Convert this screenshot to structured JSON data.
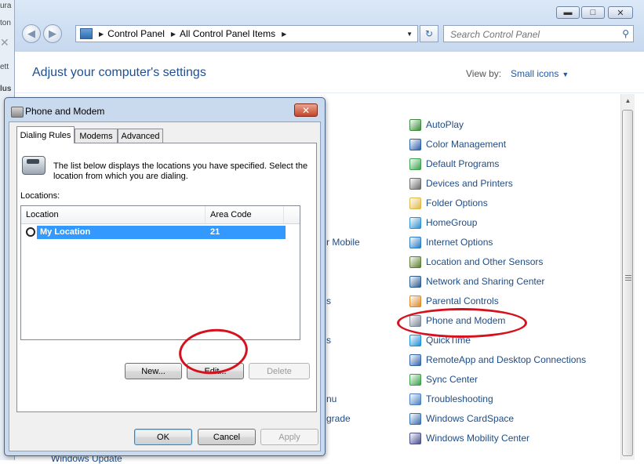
{
  "window": {
    "buttons": {
      "minimize": "▬",
      "maximize": "□",
      "close": "✕"
    }
  },
  "address": {
    "crumbs": [
      "Control Panel",
      "All Control Panel Items"
    ],
    "separator": "▶",
    "dropdown": "▼",
    "refresh": "↻"
  },
  "search": {
    "placeholder": "Search Control Panel",
    "icon": "search-icon"
  },
  "header": {
    "title": "Adjust your computer's settings",
    "view_by_label": "View by:",
    "view_by_value": "Small icons",
    "view_by_arrow": "▼"
  },
  "items": [
    {
      "label": "AutoPlay",
      "icon": "autoplay-icon",
      "color": "#3a8c3a"
    },
    {
      "label": "Color Management",
      "icon": "color-management-icon",
      "color": "#2d5ea8"
    },
    {
      "label": "Default Programs",
      "icon": "default-programs-icon",
      "color": "#3aa14a"
    },
    {
      "label": "Devices and Printers",
      "icon": "printer-icon",
      "color": "#6b6b6b"
    },
    {
      "label": "Folder Options",
      "icon": "folder-icon",
      "color": "#e0b84a"
    },
    {
      "label": "HomeGroup",
      "icon": "homegroup-icon",
      "color": "#2f8fd0"
    },
    {
      "label": "Internet Options",
      "icon": "internet-options-icon",
      "color": "#2a7bc1"
    },
    {
      "label": "Location and Other Sensors",
      "icon": "location-sensors-icon",
      "color": "#5b7f2e"
    },
    {
      "label": "Network and Sharing Center",
      "icon": "network-icon",
      "color": "#2f5c8f"
    },
    {
      "label": "Parental Controls",
      "icon": "parental-controls-icon",
      "color": "#d98a2b"
    },
    {
      "label": "Phone and Modem",
      "icon": "phone-modem-icon",
      "color": "#7c8794"
    },
    {
      "label": "QuickTime",
      "icon": "quicktime-icon",
      "color": "#1b8fd6"
    },
    {
      "label": "RemoteApp and Desktop Connections",
      "icon": "remoteapp-icon",
      "color": "#3565a8"
    },
    {
      "label": "Sync Center",
      "icon": "sync-center-icon",
      "color": "#3aa14a"
    },
    {
      "label": "Troubleshooting",
      "icon": "troubleshooting-icon",
      "color": "#4a7fc0"
    },
    {
      "label": "Windows CardSpace",
      "icon": "cardspace-icon",
      "color": "#3a6fb0"
    },
    {
      "label": "Windows Mobility Center",
      "icon": "mobility-center-icon",
      "color": "#4a4f8c"
    }
  ],
  "hidden_fragments": {
    "mobile": "r Mobile",
    "s1": "s",
    "s2": "s",
    "nu": "nu",
    "grade": "grade",
    "bottom": "Windows Update"
  },
  "dialog": {
    "title": "Phone and Modem",
    "close": "✕",
    "tabs": [
      "Dialing Rules",
      "Modems",
      "Advanced"
    ],
    "description": "The list below displays the locations you have specified. Select the location from which you are dialing.",
    "locations_label": "Locations:",
    "columns": [
      "Location",
      "Area Code"
    ],
    "rows": [
      {
        "location": "My Location",
        "area_code": "21"
      }
    ],
    "buttons": {
      "new": "New...",
      "edit": "Edit...",
      "delete": "Delete"
    },
    "footer": {
      "ok": "OK",
      "cancel": "Cancel",
      "apply": "Apply"
    }
  },
  "scrollbar": {
    "up_arrow": "▲"
  },
  "left_strip": [
    "ura",
    "ton",
    "✕",
    "ett",
    "lus"
  ],
  "colors": {
    "heading": "#1e4f93",
    "link": "#1f4c85",
    "selection": "#3399ff",
    "annotation": "#d6111d"
  }
}
